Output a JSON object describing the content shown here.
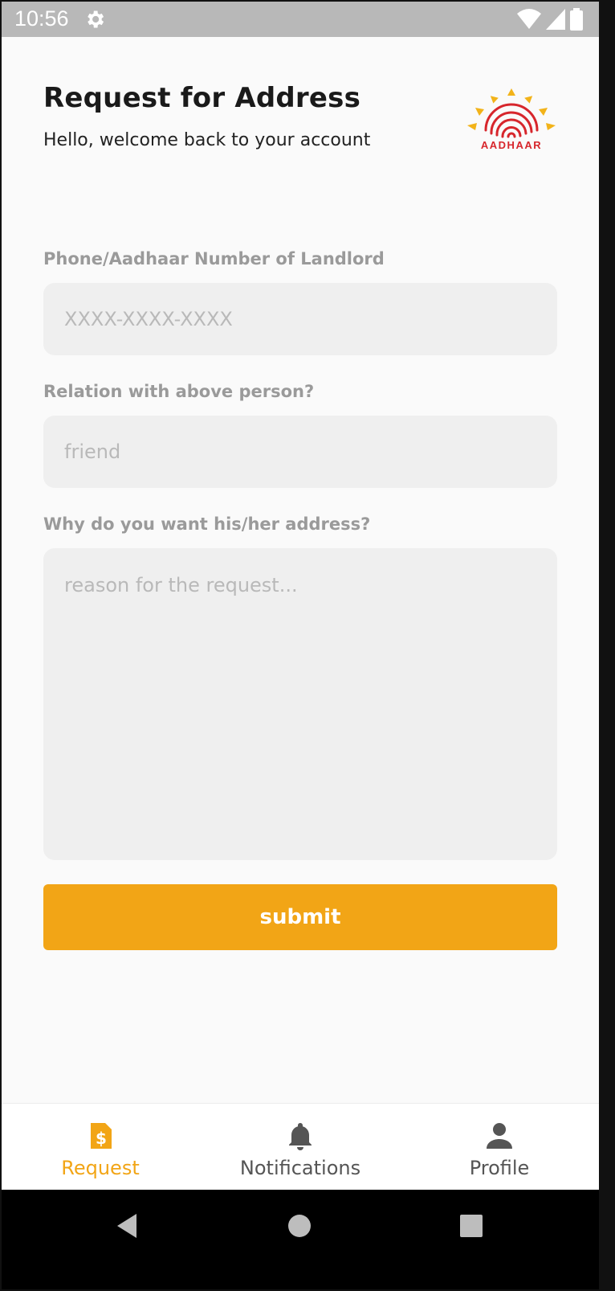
{
  "status_bar": {
    "time": "10:56",
    "icons": [
      "gear-icon",
      "wifi-icon",
      "signal-icon",
      "battery-icon"
    ]
  },
  "header": {
    "title": "Request for Address",
    "subtitle": "Hello, welcome back to your account",
    "logo_text": "AADHAAR"
  },
  "form": {
    "phone": {
      "label": "Phone/Aadhaar Number of Landlord",
      "placeholder": "XXXX-XXXX-XXXX",
      "value": ""
    },
    "relation": {
      "label": "Relation with above person?",
      "placeholder": "friend",
      "value": ""
    },
    "reason": {
      "label": "Why do you want his/her address?",
      "placeholder": "reason for the request...",
      "value": ""
    },
    "submit_label": "submit"
  },
  "bottom_nav": {
    "items": [
      {
        "label": "Request",
        "icon": "request-icon",
        "active": true
      },
      {
        "label": "Notifications",
        "icon": "bell-icon",
        "active": false
      },
      {
        "label": "Profile",
        "icon": "person-icon",
        "active": false
      }
    ]
  },
  "colors": {
    "accent": "#f2a516",
    "field_bg": "#efefef",
    "label": "#9a9a9a"
  }
}
